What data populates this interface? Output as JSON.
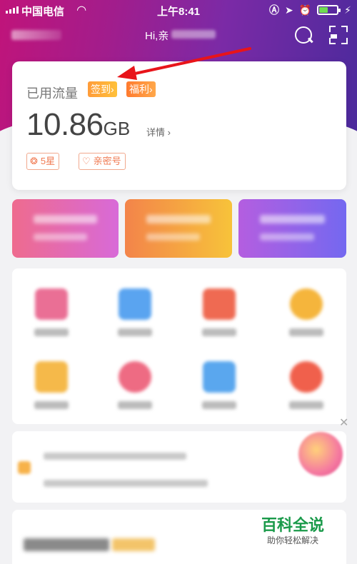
{
  "status_bar": {
    "carrier": "中国电信",
    "time": "上午8:41"
  },
  "header": {
    "greeting": "Hi,亲"
  },
  "usage_card": {
    "label": "已用流量",
    "sign_tag": "签到",
    "welfare_tag": "福利",
    "usage_value": "10.86",
    "usage_unit": "GB",
    "detail_link": "详情",
    "star_chip": "5星",
    "qinmi_chip": "亲密号"
  },
  "watermark": {
    "title": "百科全说",
    "subtitle": "助你轻松解决"
  },
  "colors": {
    "hero_gradient_start": "#c0147a",
    "hero_gradient_end": "#4b2a9c",
    "accent_orange": "#ff9c3a",
    "arrow_red": "#e8141a",
    "chip_border": "#f1a98e"
  },
  "grid_items": [
    {
      "icon_color": "#ea6f95"
    },
    {
      "icon_color": "#5aa4f0"
    },
    {
      "icon_color": "#ef6a52"
    },
    {
      "icon_color": "#f5b53c"
    },
    {
      "icon_color": "#f5b94a"
    },
    {
      "icon_color": "#ee6b83"
    },
    {
      "icon_color": "#5aa7ee"
    },
    {
      "icon_color": "#f0604c"
    }
  ]
}
